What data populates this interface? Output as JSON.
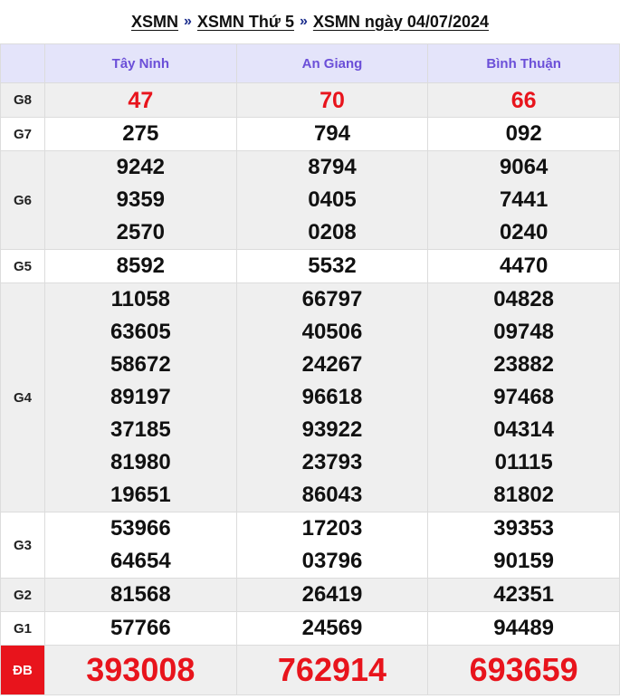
{
  "breadcrumb": {
    "items": [
      "XSMN",
      "XSMN Thứ 5",
      "XSMN ngày 04/07/2024"
    ],
    "separator": "»"
  },
  "table": {
    "provinces": [
      "Tây Ninh",
      "An Giang",
      "Bình Thuận"
    ],
    "prizes": [
      {
        "label": "G8",
        "numbers": [
          [
            "47"
          ],
          [
            "70"
          ],
          [
            "66"
          ]
        ]
      },
      {
        "label": "G7",
        "numbers": [
          [
            "275"
          ],
          [
            "794"
          ],
          [
            "092"
          ]
        ]
      },
      {
        "label": "G6",
        "numbers": [
          [
            "9242",
            "9359",
            "2570"
          ],
          [
            "8794",
            "0405",
            "0208"
          ],
          [
            "9064",
            "7441",
            "0240"
          ]
        ]
      },
      {
        "label": "G5",
        "numbers": [
          [
            "8592"
          ],
          [
            "5532"
          ],
          [
            "4470"
          ]
        ]
      },
      {
        "label": "G4",
        "numbers": [
          [
            "11058",
            "63605",
            "58672",
            "89197",
            "37185",
            "81980",
            "19651"
          ],
          [
            "66797",
            "40506",
            "24267",
            "96618",
            "93922",
            "23793",
            "86043"
          ],
          [
            "04828",
            "09748",
            "23882",
            "97468",
            "04314",
            "01115",
            "81802"
          ]
        ]
      },
      {
        "label": "G3",
        "numbers": [
          [
            "53966",
            "64654"
          ],
          [
            "17203",
            "03796"
          ],
          [
            "39353",
            "90159"
          ]
        ]
      },
      {
        "label": "G2",
        "numbers": [
          [
            "81568"
          ],
          [
            "26419"
          ],
          [
            "42351"
          ]
        ]
      },
      {
        "label": "G1",
        "numbers": [
          [
            "57766"
          ],
          [
            "24569"
          ],
          [
            "94489"
          ]
        ]
      },
      {
        "label": "ĐB",
        "numbers": [
          [
            "393008"
          ],
          [
            "762914"
          ],
          [
            "693659"
          ]
        ]
      }
    ]
  },
  "colors": {
    "header_bg": "#e4e4fa",
    "header_text": "#6b4fd8",
    "accent_red": "#e8141c",
    "row_gray": "#efefef"
  }
}
